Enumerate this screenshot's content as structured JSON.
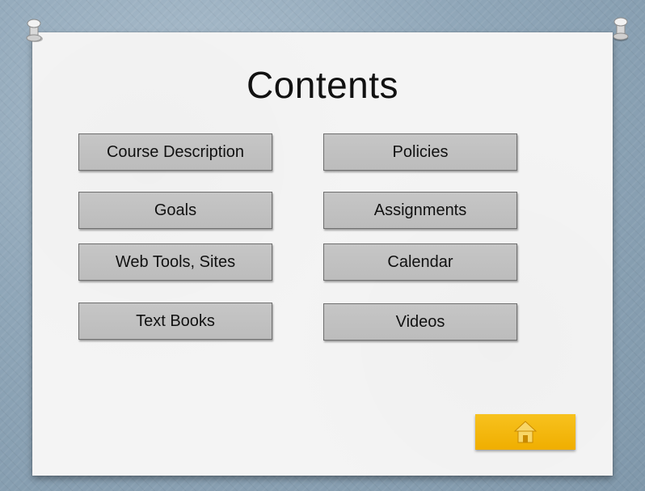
{
  "slide": {
    "title": "Contents"
  },
  "menu": {
    "course_description": "Course Description",
    "policies": "Policies",
    "goals": "Goals",
    "assignments": "Assignments",
    "web_tools_sites": "Web Tools, Sites",
    "calendar": "Calendar",
    "text_books": "Text Books",
    "videos": "Videos"
  },
  "home_button": {
    "icon": "home-icon"
  },
  "colors": {
    "board": "#8fa6b8",
    "slide": "#f4f4f4",
    "button_fill": "#c2c2c2",
    "button_border": "#6f6f6f",
    "home_fill": "#f5b800"
  }
}
